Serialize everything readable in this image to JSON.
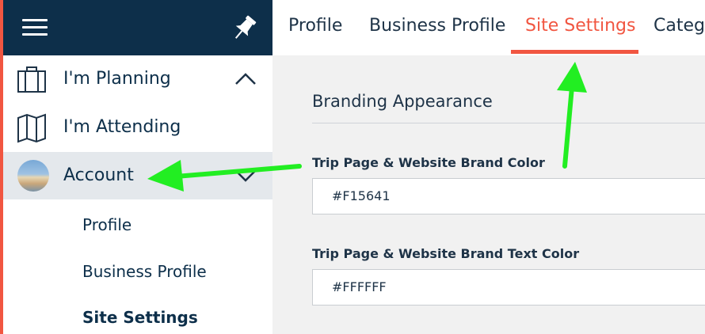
{
  "sidebar": {
    "menu_icon": "hamburger-icon",
    "pin_icon": "pin-icon",
    "items": [
      {
        "label": "I'm Planning",
        "icon": "suitcase-icon",
        "chevron": "chevron-up-icon"
      },
      {
        "label": "I'm Attending",
        "icon": "map-icon"
      },
      {
        "label": "Account",
        "icon": "avatar",
        "chevron": "chevron-down-icon"
      }
    ],
    "subitems": [
      "Profile",
      "Business Profile",
      "Site Settings"
    ]
  },
  "tabs": [
    "Profile",
    "Business Profile",
    "Site Settings",
    "Catego"
  ],
  "active_tab": "Site Settings",
  "main": {
    "section_title": "Branding Appearance",
    "fields": [
      {
        "label": "Trip Page & Website Brand Color",
        "value": "#F15641"
      },
      {
        "label": "Trip Page & Website Brand Text Color",
        "value": "#FFFFFF"
      }
    ]
  },
  "colors": {
    "sidebar_dark": "#0d2f4a",
    "accent": "#f15641",
    "annotation_arrow": "#22ee22"
  }
}
